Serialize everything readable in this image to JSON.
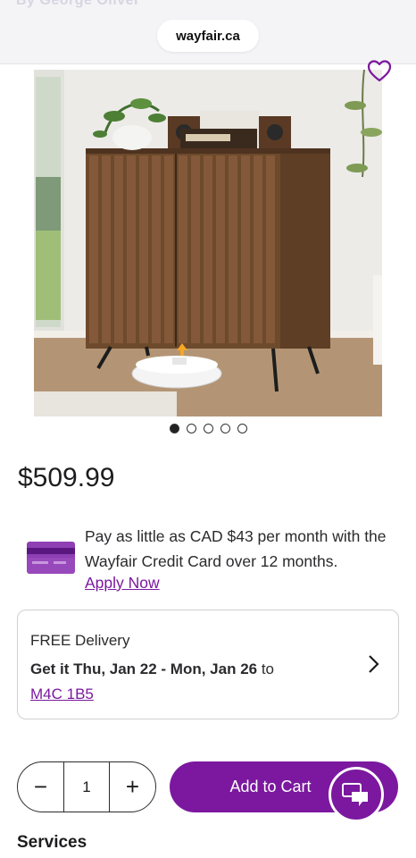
{
  "browser": {
    "url": "wayfair.ca",
    "overlay_text": "By George Oliver"
  },
  "product": {
    "image_alt": "Fluted walnut accent cabinet with record player on top",
    "carousel": {
      "count": 5,
      "active_index": 0
    },
    "price": "$509.99"
  },
  "financing": {
    "text": "Pay as little as CAD $43 per month with the Wayfair Credit Card over 12 months.",
    "link": "Apply Now"
  },
  "delivery": {
    "title": "FREE Delivery",
    "prefix": "Get it Thu, Jan 22 - Mon, Jan 26",
    "suffix": " to",
    "postal_code": "M4C 1B5"
  },
  "purchase": {
    "quantity": "1",
    "minus_symbol": "−",
    "plus_symbol": "+",
    "add_to_cart": "Add to Cart"
  },
  "section": {
    "services": "Services"
  },
  "colors": {
    "brand_purple": "#7b189f",
    "text": "#2b2b2e"
  },
  "icons": [
    "heart-icon",
    "credit-card-icon",
    "chevron-right-icon",
    "chat-icon"
  ]
}
